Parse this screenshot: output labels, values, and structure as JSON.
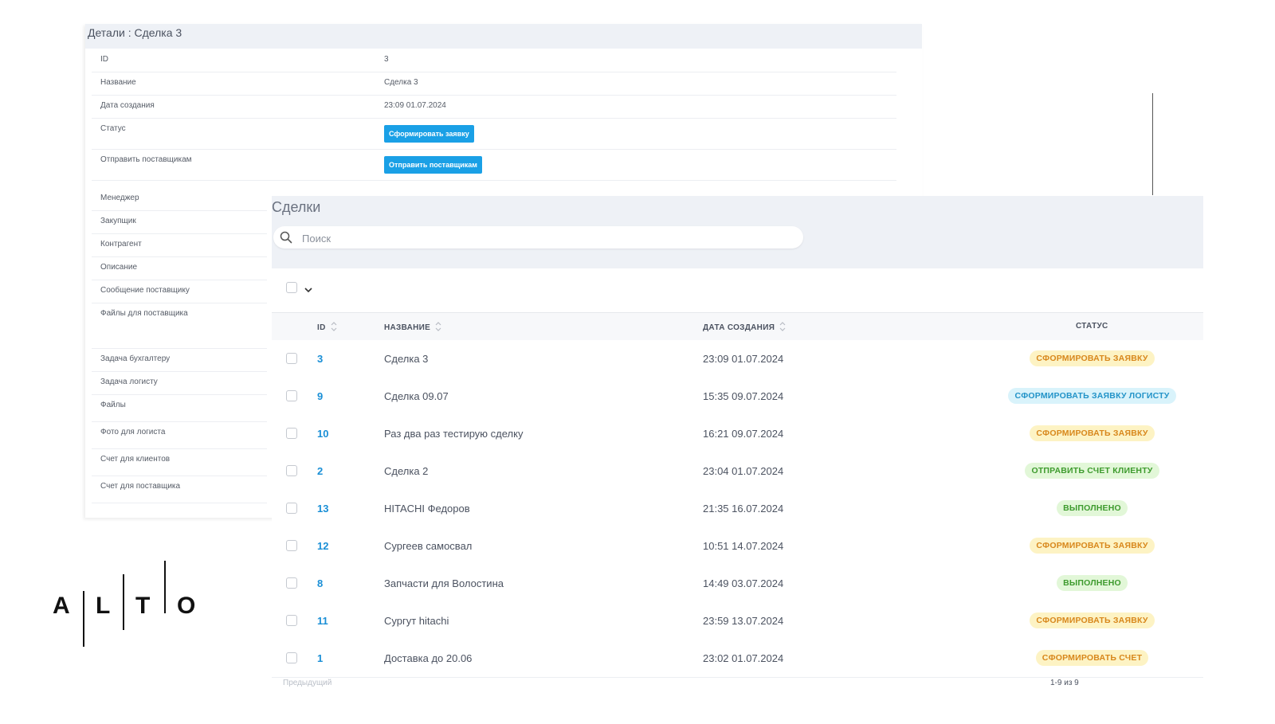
{
  "details": {
    "title": "Детали : Сделка 3",
    "rows": [
      {
        "key": "ID",
        "value": "3"
      },
      {
        "key": "Название",
        "value": "Сделка 3"
      },
      {
        "key": "Дата создания",
        "value": "23:09 01.07.2024"
      },
      {
        "key": "Статус",
        "button": "Сформировать заявку"
      },
      {
        "key": "Отправить поставщикам",
        "button": "Отправить поставщикам"
      },
      {
        "key": "Менеджер"
      },
      {
        "key": "Закупщик"
      },
      {
        "key": "Контрагент"
      },
      {
        "key": "Описание"
      },
      {
        "key": "Сообщение поставщику"
      },
      {
        "key": "Файлы для поставщика"
      },
      {
        "key": "Задача бухгалтеру"
      },
      {
        "key": "Задача логисту"
      },
      {
        "key": "Файлы"
      },
      {
        "key": "Фото для логиста"
      },
      {
        "key": "Счет для клиентов"
      },
      {
        "key": "Счет для поставщика"
      }
    ]
  },
  "deals": {
    "title": "Сделки",
    "search_placeholder": "Поиск",
    "columns": {
      "id": "ID",
      "name": "НАЗВАНИЕ",
      "date": "ДАТА СОЗДАНИЯ",
      "status": "СТАТУС"
    },
    "rows": [
      {
        "id": "3",
        "name": "Сделка 3",
        "date": "23:09 01.07.2024",
        "status": "СФОРМИРОВАТЬ ЗАЯВКУ",
        "status_color": "yellow"
      },
      {
        "id": "9",
        "name": "Сделка 09.07",
        "date": "15:35 09.07.2024",
        "status": "СФОРМИРОВАТЬ ЗАЯВКУ ЛОГИСТУ",
        "status_color": "blue"
      },
      {
        "id": "10",
        "name": "Раз два раз тестирую сделку",
        "date": "16:21 09.07.2024",
        "status": "СФОРМИРОВАТЬ ЗАЯВКУ",
        "status_color": "yellow"
      },
      {
        "id": "2",
        "name": "Сделка 2",
        "date": "23:04 01.07.2024",
        "status": "ОТПРАВИТЬ СЧЕТ КЛИЕНТУ",
        "status_color": "green"
      },
      {
        "id": "13",
        "name": "HITACHI Федоров",
        "date": "21:35 16.07.2024",
        "status": "ВЫПОЛНЕНО",
        "status_color": "green"
      },
      {
        "id": "12",
        "name": "Сургеев самосвал",
        "date": "10:51 14.07.2024",
        "status": "СФОРМИРОВАТЬ ЗАЯВКУ",
        "status_color": "yellow"
      },
      {
        "id": "8",
        "name": "Запчасти для Волостина",
        "date": "14:49 03.07.2024",
        "status": "ВЫПОЛНЕНО",
        "status_color": "green"
      },
      {
        "id": "11",
        "name": "Сургут hitachi",
        "date": "23:59 13.07.2024",
        "status": "СФОРМИРОВАТЬ ЗАЯВКУ",
        "status_color": "yellow"
      },
      {
        "id": "1",
        "name": "Доставка до 20.06",
        "date": "23:02 01.07.2024",
        "status": "СФОРМИРОВАТЬ СЧЕТ",
        "status_color": "yellow"
      }
    ],
    "pagination": {
      "prev": "Предыдущий",
      "count": "1-9 из 9"
    }
  },
  "logo": {
    "letters": [
      "A",
      "L",
      "T",
      "O"
    ]
  },
  "colors": {
    "accent": "#1aa0e6",
    "link": "#1a8fd6",
    "yellow_badge": "#fdf3c4",
    "blue_badge": "#d9f3fb",
    "green_badge": "#e2f7d8"
  }
}
